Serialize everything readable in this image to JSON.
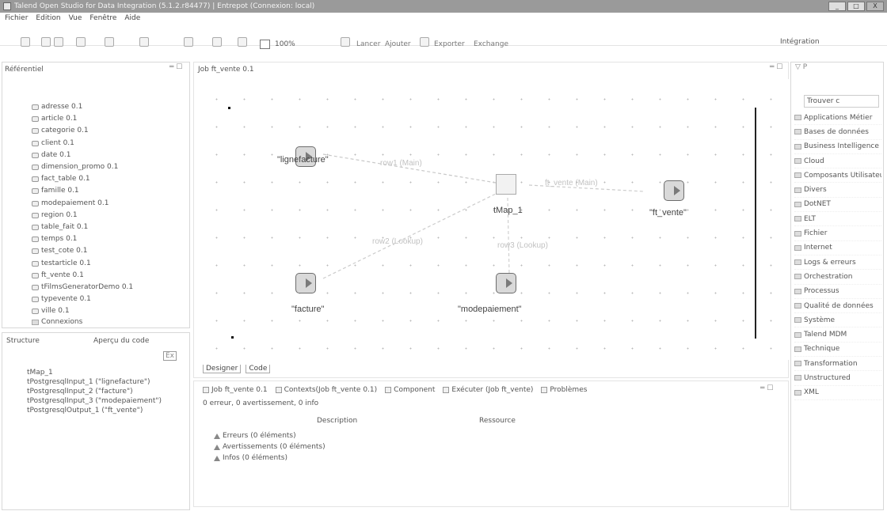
{
  "window": {
    "title": "Talend Open Studio for Data Integration (5.1.2.r84477) | Entrepot (Connexion: local)",
    "controls": [
      "_",
      "□",
      "X"
    ]
  },
  "menu": [
    "Fichier",
    "Edition",
    "Vue",
    "Fenêtre",
    "Aide"
  ],
  "toolbar": {
    "zoom": "100%",
    "left_icons": [
      "new-icon",
      "save-icon",
      "import-icon",
      "run-icon",
      "dropdown-icon",
      "undo-icon",
      "redo-icon",
      "cut-icon",
      "copy-icon"
    ],
    "links": [
      "Lancer",
      "Ajouter",
      "Exporter",
      "Exchange"
    ],
    "perspective": "Intégration"
  },
  "repository": {
    "title": "Référentiel",
    "items": [
      "adresse 0.1",
      "article 0.1",
      "categorie 0.1",
      "client 0.1",
      "date 0.1",
      "dimension_promo 0.1",
      "fact_table 0.1",
      "famille 0.1",
      "modepaiement 0.1",
      "region 0.1",
      "table_fait 0.1",
      "temps 0.1",
      "test_cote 0.1",
      "testarticle 0.1",
      "ft_vente 0.1",
      "tFilmsGeneratorDemo 0.1",
      "typevente 0.1",
      "ville 0.1"
    ],
    "folder": "Connexions"
  },
  "structure": {
    "tabs": [
      "Structure",
      "Aperçu du code"
    ],
    "items": [
      "tMap_1",
      "tPostgresqlInput_1 (\"lignefacture\")",
      "tPostgresqlInput_2 (\"facture\")",
      "tPostgresqlInput_3 (\"modepaiement\")",
      "tPostgresqlOutput_1 (\"ft_vente\")"
    ]
  },
  "editor": {
    "tab": "Job ft_vente 0.1",
    "components": [
      {
        "id": "lignefacture",
        "label": "\"lignefacture\""
      },
      {
        "id": "tmap",
        "label": "tMap_1"
      },
      {
        "id": "ft_vente",
        "label": "\"ft_vente\""
      },
      {
        "id": "facture",
        "label": "\"facture\""
      },
      {
        "id": "modepaiement",
        "label": "\"modepaiement\""
      }
    ],
    "connections": {
      "main": "row1 (Main)",
      "mapping": "ft_vente (Main)",
      "lookup1": "row2 (Lookup)",
      "lookup2": "row3 (Lookup)"
    },
    "bottom_tabs": [
      "Designer",
      "Code"
    ]
  },
  "bottom_panel": {
    "tabs": [
      "Job ft_vente 0.1",
      "Contexts(Job ft_vente 0.1)",
      "Component",
      "Exécuter (Job ft_vente)",
      "Problèmes"
    ],
    "summary": "0 erreur, 0 avertissement, 0 info",
    "columns": [
      "Description",
      "Ressource"
    ],
    "items": [
      "Erreurs (0 éléments)",
      "Avertissements (0 éléments)",
      "Infos (0 éléments)"
    ]
  },
  "palette": {
    "search": "Trouver c",
    "items": [
      "Applications Métier",
      "Bases de données",
      "Business Intelligence",
      "Cloud",
      "Composants Utilisateur",
      "Divers",
      "DotNET",
      "ELT",
      "Fichier",
      "Internet",
      "Logs & erreurs",
      "Orchestration",
      "Processus",
      "Qualité de données",
      "Système",
      "Talend MDM",
      "Technique",
      "Transformation",
      "Unstructured",
      "XML"
    ]
  }
}
